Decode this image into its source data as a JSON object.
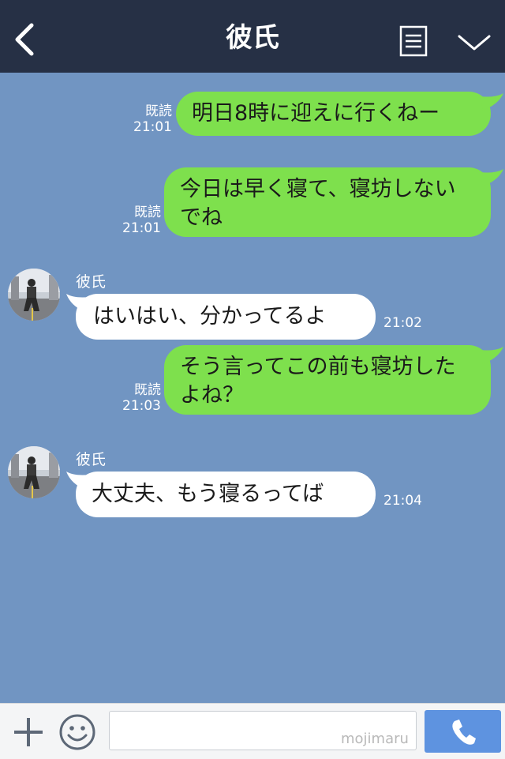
{
  "header": {
    "title": "彼氏"
  },
  "messages": [
    {
      "text": "明日8時に迎えに行くねー",
      "read": "既読",
      "time": "21:01"
    },
    {
      "text": "今日は早く寝て、寝坊しないでね",
      "read": "既読",
      "time": "21:01"
    },
    {
      "name": "彼氏",
      "text": "はいはい、分かってるよ",
      "time": "21:02"
    },
    {
      "text": "そう言ってこの前も寝坊したよね？",
      "read": "既読",
      "time": "21:03"
    },
    {
      "name": "彼氏",
      "text": "大丈夫、もう寝るってば",
      "time": "21:04"
    }
  ],
  "composer": {
    "placeholder": "",
    "watermark": "mojimaru"
  },
  "colors": {
    "header_bg": "#263045",
    "chat_bg": "#7195c2",
    "sent_bubble": "#7ee04d",
    "received_bubble": "#ffffff",
    "call_button": "#5e93e0"
  },
  "icons": {
    "back": "chevron-left-icon",
    "menu": "list-icon",
    "collapse": "chevron-down-icon",
    "add": "plus-icon",
    "emoji": "smiley-icon",
    "call": "phone-icon"
  }
}
